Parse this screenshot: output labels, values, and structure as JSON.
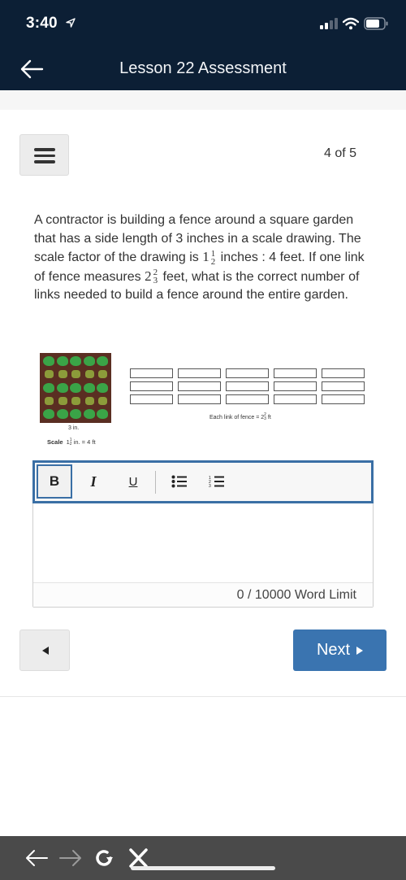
{
  "status_bar": {
    "time": "3:40",
    "icons": [
      "location-arrow-icon",
      "cellular-signal-icon",
      "wifi-icon",
      "battery-icon"
    ]
  },
  "nav": {
    "back_icon": "arrow-left-icon",
    "title": "Lesson 22 Assessment"
  },
  "assessment": {
    "menu_icon": "hamburger-menu-icon",
    "progress": "4 of 5",
    "question": {
      "part1": "A contractor is building a fence around a square garden that has a side length of 3 inches in a scale drawing. The scale factor of the drawing is ",
      "scale_whole": "1",
      "scale_num": "1",
      "scale_den": "2",
      "part2": " inches : 4 feet. If one link of fence measures ",
      "link_whole": "2",
      "link_num": "2",
      "link_den": "3",
      "part3": " feet, what is the correct number of links needed to build a fence around the entire garden."
    },
    "figure": {
      "garden_side_label": "3 in.",
      "scale_word": "Scale",
      "scale_whole": "1",
      "scale_num": "1",
      "scale_den": "2",
      "scale_rest": "in. = 4 ft",
      "fence_label_prefix": "Each link of fence = 2",
      "fence_num": "2",
      "fence_den": "3",
      "fence_label_suffix": "ft",
      "fence_rows": 3,
      "fence_cols": 5
    }
  },
  "editor": {
    "toolbar": [
      {
        "name": "bold",
        "label": "B",
        "active": true
      },
      {
        "name": "italic",
        "label": "I",
        "active": false
      },
      {
        "name": "underline",
        "label": "U",
        "active": false
      },
      {
        "name": "bulleted-list",
        "icon": "bulleted-list-icon"
      },
      {
        "name": "numbered-list",
        "icon": "numbered-list-icon"
      }
    ],
    "content": "",
    "word_count": "0 / 10000 Word Limit"
  },
  "navigation": {
    "prev_icon": "triangle-left-icon",
    "next_label": "Next",
    "next_icon": "triangle-right-icon",
    "next_color": "#3a74b0"
  },
  "browser_bar": {
    "icons": [
      "back-arrow-icon",
      "forward-arrow-icon",
      "reload-icon",
      "close-icon"
    ]
  },
  "colors": {
    "header_bg": "#0c1f35",
    "toolbar_border": "#3a6fa5",
    "browser_bar_bg": "#4a4a4a"
  }
}
